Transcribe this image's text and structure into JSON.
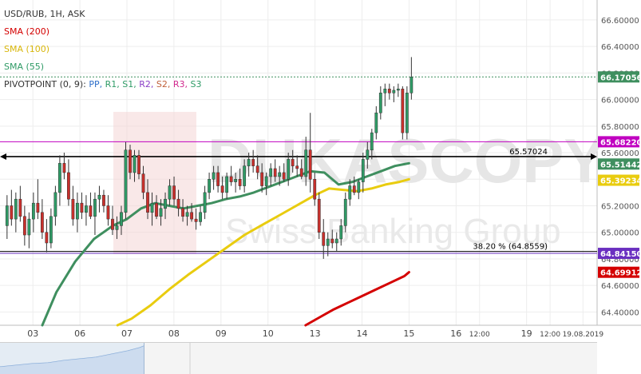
{
  "legend": {
    "symbol": "USD/RUB, 1H, ASK",
    "sma200": "SMA (200)",
    "sma100": "SMA (100)",
    "sma55": "SMA (55)",
    "pivot_title": "PIVOTPOINT (0, 9):",
    "pivot_items": [
      {
        "label": "PP,",
        "color": "#2d6ec9"
      },
      {
        "label": "R1,",
        "color": "#2f9b66"
      },
      {
        "label": "S1,",
        "color": "#2f9b66"
      },
      {
        "label": "R2,",
        "color": "#8a3fc6"
      },
      {
        "label": "S2,",
        "color": "#c0603a"
      },
      {
        "label": "R3,",
        "color": "#d12a8e"
      },
      {
        "label": "S3",
        "color": "#2f9b66"
      }
    ]
  },
  "colors": {
    "sma200": "#d40000",
    "sma100": "#e9cc0f",
    "sma55": "#3f8f5f",
    "bull": "#2f9b66",
    "bear": "#c9302c",
    "resistance": "#c000c0",
    "support_black": "#000000",
    "fib_purple": "#6a2fc0",
    "price_dashed": "#3f8f5f"
  },
  "watermark": {
    "brand": "DUKASCOPY",
    "tagline": "Swiss Banking Group"
  },
  "chart_data": {
    "type": "candlestick",
    "title": "USD/RUB, 1H, ASK",
    "ylim": [
      64.3,
      66.75
    ],
    "y_ticks": [
      64.4,
      64.6,
      64.8,
      65.0,
      65.2,
      65.4,
      65.6,
      65.8,
      66.0,
      66.2,
      66.4,
      66.6
    ],
    "y_tick_labels": [
      "64.40000",
      "64.60000",
      "64.80000",
      "65.00000",
      "65.20000",
      "65.40000",
      "65.60000",
      "65.80000",
      "66.00000",
      "66.20000",
      "66.40000",
      "66.60000"
    ],
    "x_tick_labels": [
      {
        "label": "03",
        "x": 0.5
      },
      {
        "label": "06",
        "x": 1.5
      },
      {
        "label": "07",
        "x": 2.5
      },
      {
        "label": "08",
        "x": 3.5
      },
      {
        "label": "09",
        "x": 4.5
      },
      {
        "label": "10",
        "x": 5.5
      },
      {
        "label": "13",
        "x": 6.5
      },
      {
        "label": "14",
        "x": 7.5
      },
      {
        "label": "15",
        "x": 8.5
      },
      {
        "label": "16",
        "x": 9.5
      },
      {
        "label": "12:00",
        "x": 10.0
      },
      {
        "label": "19",
        "x": 11.0
      },
      {
        "label": "12:00",
        "x": 11.5
      },
      {
        "label": "19.08.2019",
        "x": 12.2
      }
    ],
    "xlim": [
      -0.2,
      12.5
    ],
    "current_price": 66.17056,
    "current_price_label": "66.17056",
    "levels": [
      {
        "name": "resistance",
        "value": 65.6822,
        "label": "65.68220",
        "color": "#c000c0"
      },
      {
        "name": "horizontal",
        "value": 65.57024,
        "label": "65.57024",
        "color": "#000000"
      },
      {
        "name": "fib_38_2",
        "value": 64.8559,
        "label": "38.20 % (64.8559)",
        "color": "#000000"
      },
      {
        "name": "support",
        "value": 64.8415,
        "label": "64.84150",
        "color": "#6a2fc0"
      }
    ],
    "badges": [
      {
        "value": 66.17056,
        "label": "66.17056",
        "color": "#3f8f5f"
      },
      {
        "value": 65.6822,
        "label": "65.68220",
        "color": "#c000c0"
      },
      {
        "value": 65.51442,
        "label": "65.51442",
        "color": "#3f8f5f"
      },
      {
        "value": 65.39234,
        "label": "65.39234",
        "color": "#e9cc0f"
      },
      {
        "value": 64.8415,
        "label": "64.84150",
        "color": "#6a2fc0"
      },
      {
        "value": 64.69912,
        "label": "64.69912",
        "color": "#d40000"
      }
    ],
    "candles": [
      [
        65.05,
        65.28,
        64.95,
        65.2
      ],
      [
        65.2,
        65.32,
        65.05,
        65.1
      ],
      [
        65.1,
        65.3,
        65.0,
        65.25
      ],
      [
        65.25,
        65.35,
        65.08,
        65.12
      ],
      [
        65.12,
        65.2,
        64.9,
        64.98
      ],
      [
        64.98,
        65.15,
        64.88,
        65.1
      ],
      [
        65.1,
        65.3,
        65.0,
        65.22
      ],
      [
        65.22,
        65.4,
        65.1,
        65.15
      ],
      [
        65.15,
        65.25,
        64.95,
        65.0
      ],
      [
        65.0,
        65.1,
        64.85,
        64.92
      ],
      [
        64.92,
        65.18,
        64.88,
        65.12
      ],
      [
        65.12,
        65.35,
        65.05,
        65.3
      ],
      [
        65.3,
        65.58,
        65.2,
        65.52
      ],
      [
        65.52,
        65.6,
        65.4,
        65.45
      ],
      [
        65.45,
        65.55,
        65.2,
        65.25
      ],
      [
        65.25,
        65.35,
        65.05,
        65.1
      ],
      [
        65.1,
        65.3,
        65.0,
        65.22
      ],
      [
        65.22,
        65.3,
        65.1,
        65.15
      ],
      [
        65.15,
        65.28,
        65.05,
        65.2
      ],
      [
        65.2,
        65.3,
        65.1,
        65.12
      ],
      [
        65.12,
        65.3,
        64.98,
        65.25
      ],
      [
        65.25,
        65.35,
        65.15,
        65.28
      ],
      [
        65.28,
        65.32,
        65.15,
        65.2
      ],
      [
        65.2,
        65.28,
        65.05,
        65.1
      ],
      [
        65.1,
        65.2,
        64.98,
        65.02
      ],
      [
        65.02,
        65.12,
        64.95,
        65.05
      ],
      [
        65.05,
        65.2,
        64.98,
        65.15
      ],
      [
        65.15,
        65.68,
        65.1,
        65.62
      ],
      [
        65.62,
        65.66,
        65.4,
        65.45
      ],
      [
        65.45,
        65.62,
        65.38,
        65.58
      ],
      [
        65.58,
        65.62,
        65.4,
        65.44
      ],
      [
        65.44,
        65.5,
        65.25,
        65.3
      ],
      [
        65.3,
        65.4,
        65.1,
        65.15
      ],
      [
        65.15,
        65.3,
        65.05,
        65.22
      ],
      [
        65.22,
        65.28,
        65.1,
        65.12
      ],
      [
        65.12,
        65.25,
        65.05,
        65.18
      ],
      [
        65.18,
        65.3,
        65.1,
        65.25
      ],
      [
        65.25,
        65.4,
        65.2,
        65.35
      ],
      [
        65.35,
        65.42,
        65.2,
        65.25
      ],
      [
        65.25,
        65.32,
        65.12,
        65.18
      ],
      [
        65.18,
        65.25,
        65.08,
        65.12
      ],
      [
        65.12,
        65.2,
        65.05,
        65.15
      ],
      [
        65.15,
        65.22,
        65.08,
        65.1
      ],
      [
        65.1,
        65.18,
        65.02,
        65.08
      ],
      [
        65.08,
        65.2,
        65.05,
        65.15
      ],
      [
        65.15,
        65.35,
        65.1,
        65.3
      ],
      [
        65.3,
        65.45,
        65.25,
        65.4
      ],
      [
        65.4,
        65.5,
        65.32,
        65.45
      ],
      [
        65.45,
        65.5,
        65.3,
        65.35
      ],
      [
        65.35,
        65.42,
        65.25,
        65.3
      ],
      [
        65.3,
        65.45,
        65.25,
        65.42
      ],
      [
        65.42,
        65.5,
        65.35,
        65.38
      ],
      [
        65.38,
        65.45,
        65.3,
        65.4
      ],
      [
        65.4,
        65.48,
        65.32,
        65.35
      ],
      [
        65.35,
        65.55,
        65.3,
        65.5
      ],
      [
        65.5,
        65.6,
        65.42,
        65.55
      ],
      [
        65.55,
        65.62,
        65.45,
        65.5
      ],
      [
        65.5,
        65.58,
        65.4,
        65.45
      ],
      [
        65.45,
        65.52,
        65.3,
        65.35
      ],
      [
        65.35,
        65.45,
        65.28,
        65.42
      ],
      [
        65.42,
        65.52,
        65.35,
        65.48
      ],
      [
        65.48,
        65.55,
        65.38,
        65.42
      ],
      [
        65.42,
        65.5,
        65.35,
        65.45
      ],
      [
        65.45,
        65.52,
        65.38,
        65.4
      ],
      [
        65.4,
        65.6,
        65.35,
        65.55
      ],
      [
        65.55,
        65.62,
        65.45,
        65.5
      ],
      [
        65.5,
        65.58,
        65.42,
        65.48
      ],
      [
        65.48,
        65.55,
        65.4,
        65.42
      ],
      [
        65.42,
        65.72,
        65.35,
        65.62
      ],
      [
        65.62,
        65.9,
        65.3,
        65.4
      ],
      [
        65.4,
        65.45,
        65.2,
        65.25
      ],
      [
        65.25,
        65.3,
        64.95,
        65.0
      ],
      [
        65.0,
        65.1,
        64.8,
        64.9
      ],
      [
        64.9,
        65.0,
        64.82,
        64.95
      ],
      [
        64.95,
        65.02,
        64.88,
        64.92
      ],
      [
        64.92,
        65.0,
        64.86,
        64.95
      ],
      [
        64.95,
        65.1,
        64.9,
        65.05
      ],
      [
        65.05,
        65.3,
        65.0,
        65.25
      ],
      [
        65.25,
        65.4,
        65.2,
        65.35
      ],
      [
        65.35,
        65.42,
        65.28,
        65.3
      ],
      [
        65.3,
        65.4,
        65.25,
        65.38
      ],
      [
        65.38,
        65.6,
        65.3,
        65.55
      ],
      [
        65.55,
        65.68,
        65.48,
        65.62
      ],
      [
        65.62,
        65.78,
        65.55,
        65.75
      ],
      [
        65.75,
        65.95,
        65.7,
        65.9
      ],
      [
        65.9,
        66.1,
        65.85,
        66.05
      ],
      [
        66.05,
        66.12,
        65.95,
        66.08
      ],
      [
        66.08,
        66.12,
        66.0,
        66.05
      ],
      [
        66.05,
        66.1,
        65.98,
        66.07
      ],
      [
        66.07,
        66.12,
        66.02,
        66.08
      ],
      [
        66.08,
        66.1,
        65.7,
        65.75
      ],
      [
        65.75,
        66.1,
        65.7,
        66.05
      ],
      [
        66.05,
        66.32,
        66.0,
        66.17
      ]
    ],
    "sma55": {
      "x": [
        0.7,
        1.0,
        1.4,
        1.8,
        2.2,
        2.5,
        2.8,
        3.1,
        3.4,
        3.7,
        4.0,
        4.3,
        4.6,
        4.9,
        5.2,
        5.5,
        5.8,
        6.1,
        6.4,
        6.7,
        7.0,
        7.3,
        7.6,
        7.9,
        8.2,
        8.5
      ],
      "y": [
        64.3,
        64.55,
        64.78,
        64.95,
        65.05,
        65.1,
        65.18,
        65.22,
        65.2,
        65.18,
        65.2,
        65.22,
        65.25,
        65.27,
        65.3,
        65.34,
        65.38,
        65.42,
        65.46,
        65.45,
        65.36,
        65.38,
        65.42,
        65.46,
        65.5,
        65.52
      ]
    },
    "sma100": {
      "x": [
        2.3,
        2.6,
        3.0,
        3.4,
        3.8,
        4.2,
        4.6,
        5.0,
        5.4,
        5.8,
        6.2,
        6.5,
        6.8,
        7.1,
        7.4,
        7.7,
        8.0,
        8.3,
        8.5
      ],
      "y": [
        64.3,
        64.35,
        64.45,
        64.57,
        64.68,
        64.78,
        64.88,
        64.98,
        65.06,
        65.14,
        65.22,
        65.28,
        65.33,
        65.32,
        65.31,
        65.33,
        65.36,
        65.38,
        65.4
      ]
    },
    "sma200": {
      "x": [
        6.3,
        6.6,
        6.9,
        7.2,
        7.5,
        7.8,
        8.1,
        8.4,
        8.5
      ],
      "y": [
        64.3,
        64.36,
        64.42,
        64.47,
        64.52,
        64.57,
        64.62,
        64.67,
        64.7
      ]
    }
  }
}
